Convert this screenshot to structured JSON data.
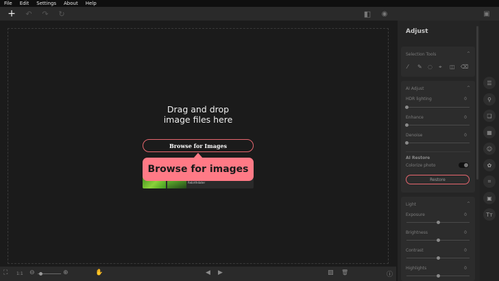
{
  "menu": [
    "File",
    "Edit",
    "Settings",
    "About",
    "Help"
  ],
  "toolbar": {
    "new": "+",
    "undo": "↶",
    "redo": "↷",
    "refresh": "↻",
    "compare": "◧",
    "preview": "◉",
    "save": "▣"
  },
  "drop": {
    "line1": "Drag and drop",
    "line2": "image files here",
    "browse_label": "Browse for Images",
    "tooltip": "Browse for images",
    "sample_label": "Rebirthdater"
  },
  "bottom": {
    "fit": "⛶",
    "one_to_one": "1:1",
    "zoom_out": "⊖",
    "zoom_in": "⊕",
    "hand": "✋",
    "prev": "◀",
    "next": "▶",
    "image": "▨",
    "delete": "🗑",
    "info": "ⓘ"
  },
  "panel": {
    "title": "Adjust",
    "selection_tools": {
      "title": "Selection Tools",
      "tools": [
        "⁄",
        "✎",
        "◌",
        "⌖",
        "◫",
        "⌫"
      ]
    },
    "ai_adjust": {
      "title": "AI Adjust",
      "sliders": [
        {
          "label": "HDR lighting",
          "value": "0",
          "level": 0
        },
        {
          "label": "Enhance",
          "value": "0",
          "level": 0
        },
        {
          "label": "Denoise",
          "value": "0",
          "level": 0
        }
      ],
      "restore_title": "AI Restore",
      "colorize_label": "Colorize photo",
      "colorize_on": false,
      "restore_button": "Restore"
    },
    "light": {
      "title": "Light",
      "sliders": [
        {
          "label": "Exposure",
          "value": "0",
          "level": 0.5
        },
        {
          "label": "Brightness",
          "value": "0",
          "level": 0.5
        },
        {
          "label": "Contrast",
          "value": "0",
          "level": 0.5
        },
        {
          "label": "Highlights",
          "value": "0",
          "level": 0.5
        }
      ]
    }
  },
  "rightbar_icons": [
    "sliders-icon",
    "person-icon",
    "layers-icon",
    "texture-icon",
    "face-icon",
    "color-icon",
    "crop-icon",
    "frame-icon",
    "text-icon"
  ],
  "rightbar_glyphs": [
    "☰",
    "⚲",
    "❏",
    "▦",
    "☺",
    "✿",
    "⌗",
    "▣",
    "Tт"
  ],
  "colors": {
    "accent": "#ff7a86",
    "button_border": "#e8676f"
  }
}
